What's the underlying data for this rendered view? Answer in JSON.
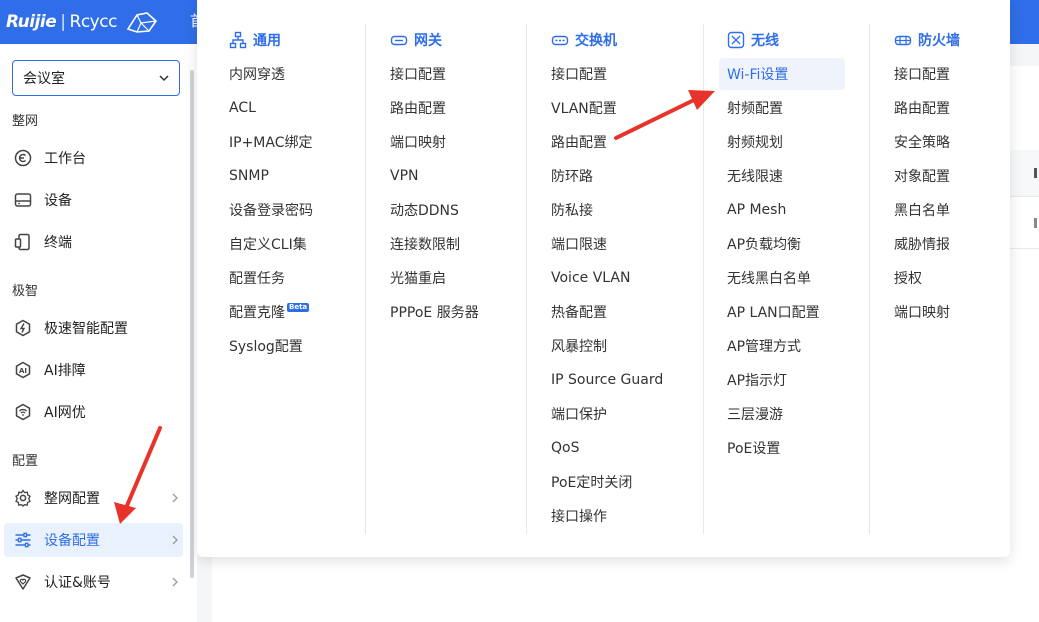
{
  "app": {
    "brand": "Ruijie",
    "brand_sub": "Rcycc",
    "top_tab": "首"
  },
  "colors": {
    "accent": "#2f6ee8",
    "annotation_arrow": "#e8332a"
  },
  "sidebar": {
    "site": "会议室",
    "groups": [
      {
        "title": "整网",
        "items": [
          {
            "label": "工作台",
            "icon": "dashboard-icon"
          },
          {
            "label": "设备",
            "icon": "device-icon"
          },
          {
            "label": "终端",
            "icon": "terminal-icon"
          }
        ]
      },
      {
        "title": "极智",
        "items": [
          {
            "label": "极速智能配置",
            "icon": "gear-smart-icon"
          },
          {
            "label": "AI排障",
            "icon": "ai-troubleshoot-icon"
          },
          {
            "label": "AI网优",
            "icon": "wifi-optimize-icon"
          }
        ]
      },
      {
        "title": "配置",
        "items": [
          {
            "label": "整网配置",
            "icon": "gear-icon"
          },
          {
            "label": "设备配置",
            "icon": "sliders-icon",
            "active": true
          },
          {
            "label": "认证&账号",
            "icon": "shield-heart-icon"
          }
        ]
      }
    ]
  },
  "menu": {
    "columns": [
      {
        "title": "通用",
        "icon": "network-tree-icon",
        "items": [
          "内网穿透",
          "ACL",
          "IP+MAC绑定",
          "SNMP",
          "设备登录密码",
          "自定义CLI集",
          "配置任务",
          "配置克隆",
          "Syslog配置"
        ],
        "beta_index": 7,
        "beta_label": "Beta"
      },
      {
        "title": "网关",
        "icon": "router-icon",
        "items": [
          "接口配置",
          "路由配置",
          "端口映射",
          "VPN",
          "动态DDNS",
          "连接数限制",
          "光猫重启",
          "PPPoE 服务器"
        ]
      },
      {
        "title": "交换机",
        "icon": "switch-icon",
        "items": [
          "接口配置",
          "VLAN配置",
          "路由配置",
          "防环路",
          "防私接",
          "端口限速",
          "Voice VLAN",
          "热备配置",
          "风暴控制",
          "IP Source Guard",
          "端口保护",
          "QoS",
          "PoE定时关闭",
          "接口操作"
        ]
      },
      {
        "title": "无线",
        "icon": "wireless-icon",
        "items": [
          "Wi-Fi设置",
          "射频配置",
          "射频规划",
          "无线限速",
          "AP Mesh",
          "AP负载均衡",
          "无线黑白名单",
          "AP LAN口配置",
          "AP管理方式",
          "AP指示灯",
          "三层漫游",
          "PoE设置"
        ],
        "highlight_index": 0
      },
      {
        "title": "防火墙",
        "icon": "firewall-icon",
        "items": [
          "接口配置",
          "路由配置",
          "安全策略",
          "对象配置",
          "黑白名单",
          "威胁情报",
          "授权",
          "端口映射"
        ]
      }
    ]
  }
}
